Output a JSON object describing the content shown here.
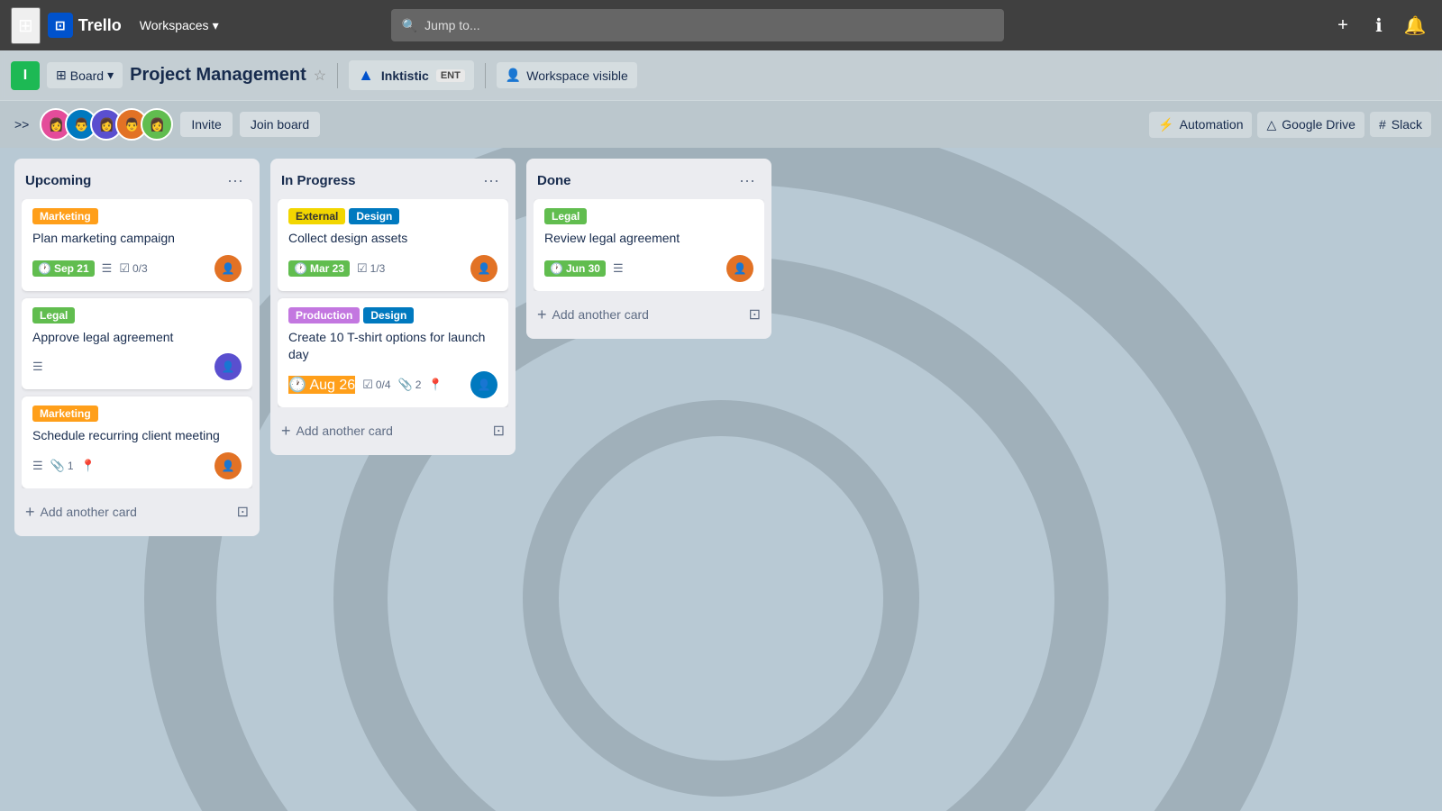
{
  "nav": {
    "logo_text": "Trello",
    "workspaces_label": "Workspaces",
    "search_placeholder": "Jump to...",
    "add_icon": "+",
    "info_icon": "ℹ",
    "notif_icon": "🔔"
  },
  "board_header": {
    "user_initial": "I",
    "view_label": "Board",
    "board_title": "Project Management",
    "workspace_name": "Inktistic",
    "ent_badge": "ENT",
    "visibility_label": "Workspace visible"
  },
  "board_subheader": {
    "invite_label": "Invite",
    "join_label": "Join board",
    "automation_label": "Automation",
    "gdrive_label": "Google Drive",
    "slack_label": "Slack"
  },
  "columns": [
    {
      "id": "upcoming",
      "title": "Upcoming",
      "cards": [
        {
          "id": "c1",
          "labels": [
            {
              "text": "Marketing",
              "color": "orange"
            }
          ],
          "title": "Plan marketing campaign",
          "due": "Sep 21",
          "has_desc": true,
          "checklist": "0/3",
          "avatar": "av1"
        },
        {
          "id": "c2",
          "labels": [
            {
              "text": "Legal",
              "color": "green"
            }
          ],
          "title": "Approve legal agreement",
          "has_desc": true,
          "avatar": "av2"
        },
        {
          "id": "c3",
          "labels": [
            {
              "text": "Marketing",
              "color": "orange"
            }
          ],
          "title": "Schedule recurring client meeting",
          "has_desc": true,
          "attachments": "1",
          "has_location": true,
          "avatar": "av1"
        }
      ],
      "add_card_label": "Add another card"
    },
    {
      "id": "inprogress",
      "title": "In Progress",
      "cards": [
        {
          "id": "c4",
          "labels": [
            {
              "text": "External",
              "color": "yellow"
            },
            {
              "text": "Design",
              "color": "blue"
            }
          ],
          "title": "Collect design assets",
          "due": "Mar 23",
          "due_color": "green",
          "checklist": "1/3",
          "avatar": "av1"
        },
        {
          "id": "c5",
          "labels": [
            {
              "text": "Production",
              "color": "purple"
            },
            {
              "text": "Design",
              "color": "blue"
            }
          ],
          "title": "Create 10 T-shirt options for launch day",
          "due": "Aug 26",
          "due_color": "orange",
          "attachments": "2",
          "checklist": "0/4",
          "has_location": true,
          "avatar": "av3"
        }
      ],
      "add_card_label": "Add another card"
    },
    {
      "id": "done",
      "title": "Done",
      "cards": [
        {
          "id": "c6",
          "labels": [
            {
              "text": "Legal",
              "color": "green"
            }
          ],
          "title": "Review legal agreement",
          "due": "Jun 30",
          "due_color": "green",
          "has_desc": true,
          "avatar": "av1"
        }
      ],
      "add_card_label": "Add another card"
    }
  ]
}
